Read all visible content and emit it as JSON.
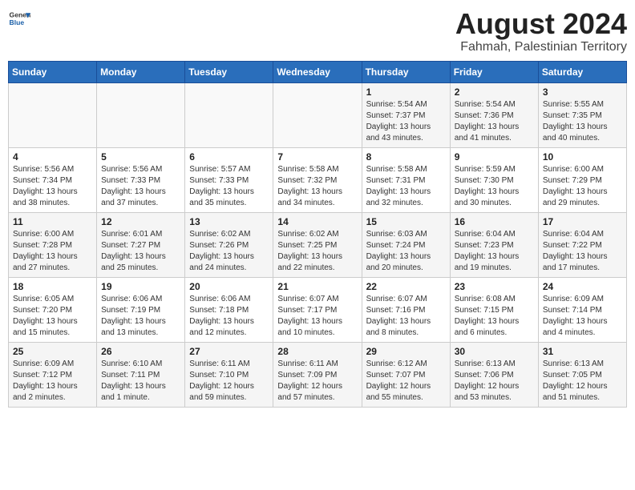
{
  "header": {
    "logo_line1": "General",
    "logo_line2": "Blue",
    "title": "August 2024",
    "subtitle": "Fahmah, Palestinian Territory"
  },
  "days": [
    "Sunday",
    "Monday",
    "Tuesday",
    "Wednesday",
    "Thursday",
    "Friday",
    "Saturday"
  ],
  "weeks": [
    [
      {
        "date": "",
        "info": ""
      },
      {
        "date": "",
        "info": ""
      },
      {
        "date": "",
        "info": ""
      },
      {
        "date": "",
        "info": ""
      },
      {
        "date": "1",
        "info": "Sunrise: 5:54 AM\nSunset: 7:37 PM\nDaylight: 13 hours\nand 43 minutes."
      },
      {
        "date": "2",
        "info": "Sunrise: 5:54 AM\nSunset: 7:36 PM\nDaylight: 13 hours\nand 41 minutes."
      },
      {
        "date": "3",
        "info": "Sunrise: 5:55 AM\nSunset: 7:35 PM\nDaylight: 13 hours\nand 40 minutes."
      }
    ],
    [
      {
        "date": "4",
        "info": "Sunrise: 5:56 AM\nSunset: 7:34 PM\nDaylight: 13 hours\nand 38 minutes."
      },
      {
        "date": "5",
        "info": "Sunrise: 5:56 AM\nSunset: 7:33 PM\nDaylight: 13 hours\nand 37 minutes."
      },
      {
        "date": "6",
        "info": "Sunrise: 5:57 AM\nSunset: 7:33 PM\nDaylight: 13 hours\nand 35 minutes."
      },
      {
        "date": "7",
        "info": "Sunrise: 5:58 AM\nSunset: 7:32 PM\nDaylight: 13 hours\nand 34 minutes."
      },
      {
        "date": "8",
        "info": "Sunrise: 5:58 AM\nSunset: 7:31 PM\nDaylight: 13 hours\nand 32 minutes."
      },
      {
        "date": "9",
        "info": "Sunrise: 5:59 AM\nSunset: 7:30 PM\nDaylight: 13 hours\nand 30 minutes."
      },
      {
        "date": "10",
        "info": "Sunrise: 6:00 AM\nSunset: 7:29 PM\nDaylight: 13 hours\nand 29 minutes."
      }
    ],
    [
      {
        "date": "11",
        "info": "Sunrise: 6:00 AM\nSunset: 7:28 PM\nDaylight: 13 hours\nand 27 minutes."
      },
      {
        "date": "12",
        "info": "Sunrise: 6:01 AM\nSunset: 7:27 PM\nDaylight: 13 hours\nand 25 minutes."
      },
      {
        "date": "13",
        "info": "Sunrise: 6:02 AM\nSunset: 7:26 PM\nDaylight: 13 hours\nand 24 minutes."
      },
      {
        "date": "14",
        "info": "Sunrise: 6:02 AM\nSunset: 7:25 PM\nDaylight: 13 hours\nand 22 minutes."
      },
      {
        "date": "15",
        "info": "Sunrise: 6:03 AM\nSunset: 7:24 PM\nDaylight: 13 hours\nand 20 minutes."
      },
      {
        "date": "16",
        "info": "Sunrise: 6:04 AM\nSunset: 7:23 PM\nDaylight: 13 hours\nand 19 minutes."
      },
      {
        "date": "17",
        "info": "Sunrise: 6:04 AM\nSunset: 7:22 PM\nDaylight: 13 hours\nand 17 minutes."
      }
    ],
    [
      {
        "date": "18",
        "info": "Sunrise: 6:05 AM\nSunset: 7:20 PM\nDaylight: 13 hours\nand 15 minutes."
      },
      {
        "date": "19",
        "info": "Sunrise: 6:06 AM\nSunset: 7:19 PM\nDaylight: 13 hours\nand 13 minutes."
      },
      {
        "date": "20",
        "info": "Sunrise: 6:06 AM\nSunset: 7:18 PM\nDaylight: 13 hours\nand 12 minutes."
      },
      {
        "date": "21",
        "info": "Sunrise: 6:07 AM\nSunset: 7:17 PM\nDaylight: 13 hours\nand 10 minutes."
      },
      {
        "date": "22",
        "info": "Sunrise: 6:07 AM\nSunset: 7:16 PM\nDaylight: 13 hours\nand 8 minutes."
      },
      {
        "date": "23",
        "info": "Sunrise: 6:08 AM\nSunset: 7:15 PM\nDaylight: 13 hours\nand 6 minutes."
      },
      {
        "date": "24",
        "info": "Sunrise: 6:09 AM\nSunset: 7:14 PM\nDaylight: 13 hours\nand 4 minutes."
      }
    ],
    [
      {
        "date": "25",
        "info": "Sunrise: 6:09 AM\nSunset: 7:12 PM\nDaylight: 13 hours\nand 2 minutes."
      },
      {
        "date": "26",
        "info": "Sunrise: 6:10 AM\nSunset: 7:11 PM\nDaylight: 13 hours\nand 1 minute."
      },
      {
        "date": "27",
        "info": "Sunrise: 6:11 AM\nSunset: 7:10 PM\nDaylight: 12 hours\nand 59 minutes."
      },
      {
        "date": "28",
        "info": "Sunrise: 6:11 AM\nSunset: 7:09 PM\nDaylight: 12 hours\nand 57 minutes."
      },
      {
        "date": "29",
        "info": "Sunrise: 6:12 AM\nSunset: 7:07 PM\nDaylight: 12 hours\nand 55 minutes."
      },
      {
        "date": "30",
        "info": "Sunrise: 6:13 AM\nSunset: 7:06 PM\nDaylight: 12 hours\nand 53 minutes."
      },
      {
        "date": "31",
        "info": "Sunrise: 6:13 AM\nSunset: 7:05 PM\nDaylight: 12 hours\nand 51 minutes."
      }
    ]
  ]
}
